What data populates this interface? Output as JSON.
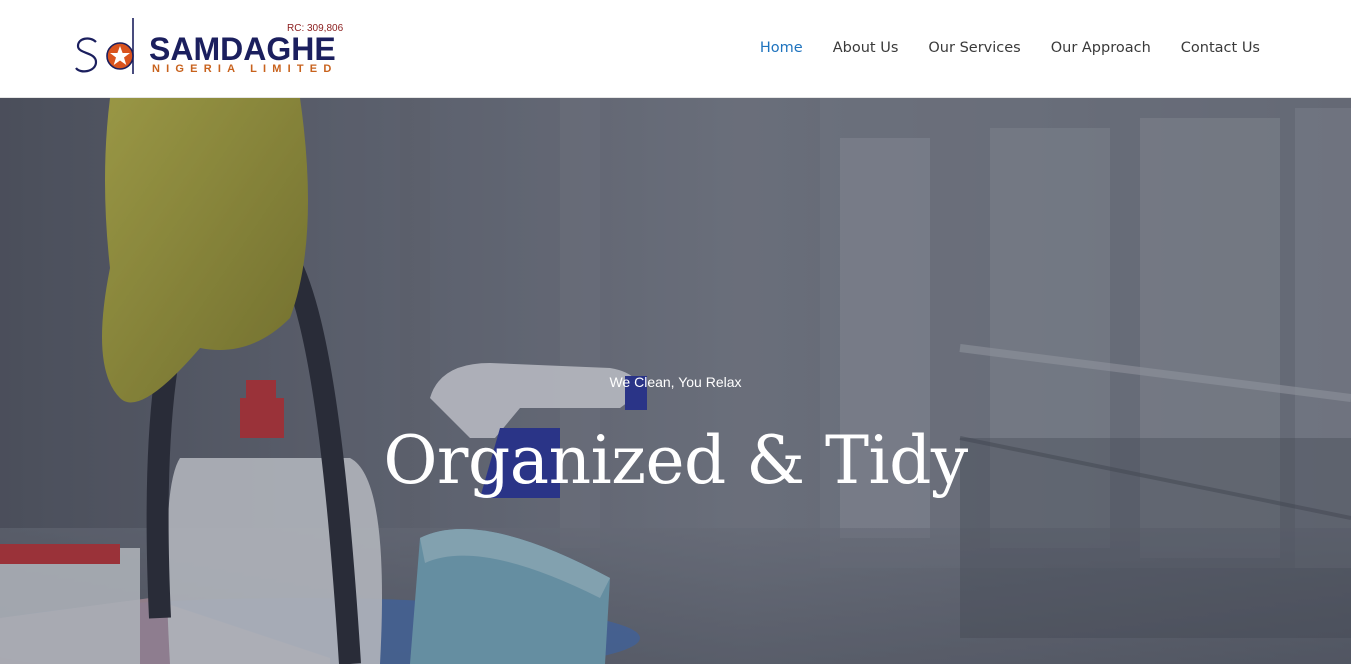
{
  "brand": {
    "name": "SAMDAGHE",
    "subtitle": "NIGERIA LIMITED",
    "registration": "RC: 309,806",
    "colors": {
      "navy": "#1b1f5e",
      "orange": "#c8621d",
      "star_circle": "#d9531e"
    }
  },
  "nav": {
    "items": [
      {
        "label": "Home",
        "active": true
      },
      {
        "label": "About Us",
        "active": false
      },
      {
        "label": "Our Services",
        "active": false
      },
      {
        "label": "Our Approach",
        "active": false
      },
      {
        "label": "Contact Us",
        "active": false
      }
    ],
    "active_color": "#1e73be"
  },
  "hero": {
    "tagline": "We Clean, You Relax",
    "title": "Organized & Tidy",
    "background_description_icon": "cleaning-supplies-photo"
  }
}
